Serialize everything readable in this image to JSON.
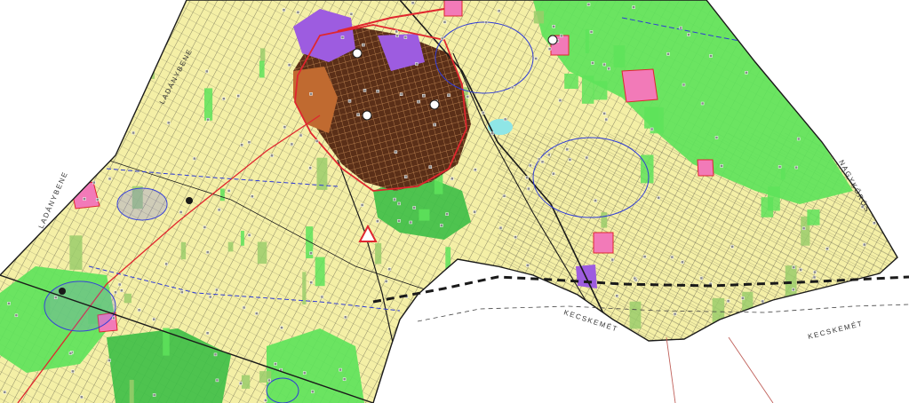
{
  "map": {
    "labels": {
      "ladanybene_north": "LADÁNYBENE",
      "ladanybene_west": "LADÁNYBENE",
      "nagykoros": "NAGYKŐRÖS",
      "kecskemet_center": "KECSKEMÉT",
      "kecskemet_east": "KECSKEMÉT"
    },
    "colors": {
      "background": "#ffffff",
      "agricultural": "#f4efa6",
      "agricultural_alt": "#eee493",
      "forest": "#5ee35b",
      "forest_dark": "#3fbf48",
      "grassland": "#9acd6b",
      "urban_core": "#6b3a20",
      "urban_mixed": "#c06a30",
      "institutional": "#9d5ce0",
      "special_zone": "#f27ab8",
      "water": "#8fe6e6",
      "boundary_red": "#e0262e",
      "boundary_blue": "#2f3bd6",
      "parcel_lines": "#2d2d2d",
      "county_border": "#1a1a1a"
    }
  }
}
